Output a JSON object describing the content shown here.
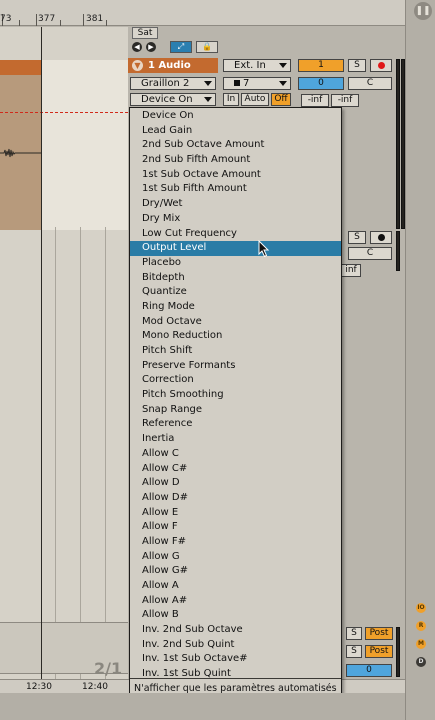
{
  "ruler": {
    "marks": [
      "73",
      "377",
      "381"
    ]
  },
  "arrangement": {
    "page_indicator": "2/1",
    "time_labels": [
      "12:30",
      "12:40"
    ]
  },
  "track": {
    "sat_label": "Sat",
    "title": "1 Audio",
    "device_select": "Graillon 2",
    "param_select": "Device On",
    "input_type": "Ext. In",
    "input_channel": "7",
    "monitor": [
      "In",
      "Auto",
      "Off"
    ],
    "track_number": "1",
    "solo": "S",
    "volume": "0",
    "pan": "C",
    "send_a": "-inf",
    "send_b": "-inf"
  },
  "track2": {
    "solo": "S",
    "pan": "C",
    "send": "inf"
  },
  "lower_tracks": [
    {
      "solo": "S",
      "post": "Post"
    },
    {
      "solo": "S",
      "post": "Post"
    }
  ],
  "master": {
    "volume": "0"
  },
  "menu": {
    "items": [
      "Device On",
      "Lead Gain",
      "2nd Sub Octave Amount",
      "2nd Sub Fifth Amount",
      "1st Sub Octave Amount",
      "1st Sub Fifth Amount",
      "Dry/Wet",
      "Dry Mix",
      "Low Cut Frequency",
      "Output Level",
      "Placebo",
      "Bitdepth",
      "Quantize",
      "Ring Mode",
      "Mod Octave",
      "Mono Reduction",
      "Pitch Shift",
      "Preserve Formants",
      "Correction",
      "Pitch Smoothing",
      "Snap Range",
      "Reference",
      "Inertia",
      "Allow C",
      "Allow C#",
      "Allow D",
      "Allow D#",
      "Allow E",
      "Allow F",
      "Allow F#",
      "Allow G",
      "Allow G#",
      "Allow A",
      "Allow A#",
      "Allow B",
      "Inv. 2nd Sub Octave",
      "Inv. 2nd Sub Quint",
      "Inv. 1st Sub Octave#",
      "Inv. 1st Sub Quint"
    ],
    "selected": "Output Level",
    "footer": "N'afficher que les paramètres automatisés"
  },
  "side_badges": [
    "IO",
    "R",
    "M",
    "D"
  ],
  "colors": {
    "track_orange": "#c36a2f",
    "selection_blue": "#2a7ca6",
    "button_orange": "#f0a02a",
    "button_blue": "#4fa5dc",
    "record_red": "#e01818",
    "automation_line": "#d12a1a"
  }
}
